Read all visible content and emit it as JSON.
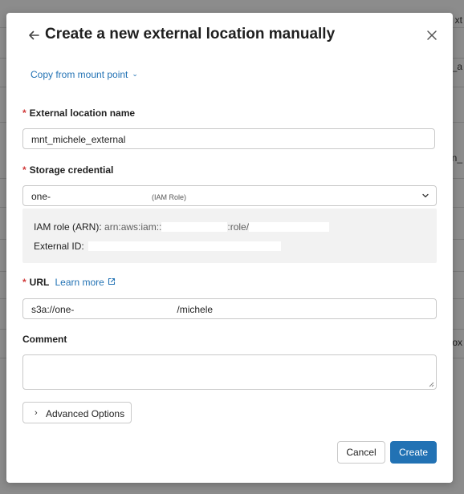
{
  "background": {
    "fragments": [
      "xt",
      "_a",
      "n_",
      "ox"
    ]
  },
  "dialog": {
    "title": "Create a new external location manually",
    "copy_from_mount_point": "Copy from mount point",
    "external_location_name": {
      "label": "External location name",
      "value": "mnt_michele_external"
    },
    "storage_credential": {
      "label": "Storage credential",
      "value": "one-",
      "badge": "(IAM Role)",
      "iam_role_label": "IAM role (ARN):",
      "iam_role_value_prefix": "arn:aws:iam::",
      "iam_role_value_mid": ":role/",
      "external_id_label": "External ID:"
    },
    "url": {
      "label": "URL",
      "learn_more": "Learn more",
      "value_prefix": "s3a://one-",
      "value_suffix": "/michele"
    },
    "comment": {
      "label": "Comment",
      "value": ""
    },
    "advanced_options": "Advanced Options",
    "cancel": "Cancel",
    "create": "Create"
  },
  "colors": {
    "accent": "#2272b4",
    "required": "#d13b3b"
  }
}
